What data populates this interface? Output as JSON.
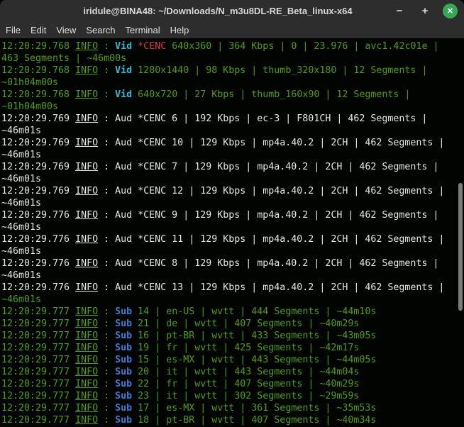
{
  "window": {
    "title": "iridule@BINA48: ~/Downloads/N_m3u8DL-RE_Beta_linux-x64",
    "controls": {
      "minimize": "−",
      "maximize": "+",
      "close": "✕"
    }
  },
  "menubar": {
    "items": [
      "File",
      "Edit",
      "View",
      "Search",
      "Terminal",
      "Help"
    ]
  },
  "colors": {
    "chrome": "#2d2d2d",
    "terminal_bg": "#020402",
    "green": "#539c10",
    "cyan": "#2fb9d4",
    "blue": "#3d7bd8",
    "red": "#e03c3c",
    "white": "#e6e6e6",
    "title_text": "#d8d8d8",
    "menu_text": "#e0e0e0",
    "control_icon": "#dcdcdc",
    "close_button": "#36a854",
    "scrollbar_thumb": "#7d7d7d"
  },
  "terminal": {
    "rows": [
      [
        {
          "t": "12:20:29.768 ",
          "s": "g"
        },
        {
          "t": "INFO",
          "s": "gu"
        },
        {
          "t": " : ",
          "s": "g"
        },
        {
          "t": "Vid",
          "s": "c"
        },
        {
          "t": " ",
          "s": "g"
        },
        {
          "t": "*CENC",
          "s": "r"
        },
        {
          "t": " 640x360 | 364 Kbps | 0 | 23.976 | avc1.42c01e |",
          "s": "g"
        }
      ],
      [
        {
          "t": "463 Segments | ~46m00s",
          "s": "g"
        }
      ],
      [
        {
          "t": "12:20:29.768 ",
          "s": "g"
        },
        {
          "t": "INFO",
          "s": "gu"
        },
        {
          "t": " : ",
          "s": "g"
        },
        {
          "t": "Vid",
          "s": "c"
        },
        {
          "t": " 1280x1440 | 98 Kbps | thumb_320x180 | 12 Segments |",
          "s": "g"
        }
      ],
      [
        {
          "t": "~01h04m00s",
          "s": "g"
        }
      ],
      [
        {
          "t": "12:20:29.768 ",
          "s": "g"
        },
        {
          "t": "INFO",
          "s": "gu"
        },
        {
          "t": " : ",
          "s": "g"
        },
        {
          "t": "Vid",
          "s": "c"
        },
        {
          "t": " 640x720 | 27 Kbps | thumb_160x90 | 12 Segments |",
          "s": "g"
        }
      ],
      [
        {
          "t": "~01h04m00s",
          "s": "g"
        }
      ],
      [
        {
          "t": "12:20:29.769 ",
          "s": "w"
        },
        {
          "t": "INFO",
          "s": "wu"
        },
        {
          "t": " : Aud *CENC 6 | 192 Kbps | ec-3 | F801CH | 462 Segments |",
          "s": "w"
        }
      ],
      [
        {
          "t": "~46m01s",
          "s": "w"
        }
      ],
      [
        {
          "t": "12:20:29.769 ",
          "s": "w"
        },
        {
          "t": "INFO",
          "s": "wu"
        },
        {
          "t": " : Aud *CENC 10 | 129 Kbps | mp4a.40.2 | 2CH | 462 Segments |",
          "s": "w"
        }
      ],
      [
        {
          "t": "~46m01s",
          "s": "w"
        }
      ],
      [
        {
          "t": "12:20:29.769 ",
          "s": "w"
        },
        {
          "t": "INFO",
          "s": "wu"
        },
        {
          "t": " : Aud *CENC 7 | 129 Kbps | mp4a.40.2 | 2CH | 462 Segments |",
          "s": "w"
        }
      ],
      [
        {
          "t": "~46m01s",
          "s": "w"
        }
      ],
      [
        {
          "t": "12:20:29.769 ",
          "s": "w"
        },
        {
          "t": "INFO",
          "s": "wu"
        },
        {
          "t": " : Aud *CENC 12 | 129 Kbps | mp4a.40.2 | 2CH | 462 Segments |",
          "s": "w"
        }
      ],
      [
        {
          "t": "~46m01s",
          "s": "w"
        }
      ],
      [
        {
          "t": "12:20:29.776 ",
          "s": "w"
        },
        {
          "t": "INFO",
          "s": "wu"
        },
        {
          "t": " : Aud *CENC 9 | 129 Kbps | mp4a.40.2 | 2CH | 462 Segments |",
          "s": "w"
        }
      ],
      [
        {
          "t": "~46m01s",
          "s": "w"
        }
      ],
      [
        {
          "t": "12:20:29.776 ",
          "s": "w"
        },
        {
          "t": "INFO",
          "s": "wu"
        },
        {
          "t": " : Aud *CENC 11 | 129 Kbps | mp4a.40.2 | 2CH | 462 Segments |",
          "s": "w"
        }
      ],
      [
        {
          "t": "~46m01s",
          "s": "w"
        }
      ],
      [
        {
          "t": "12:20:29.776 ",
          "s": "w"
        },
        {
          "t": "INFO",
          "s": "wu"
        },
        {
          "t": " : Aud *CENC 8 | 129 Kbps | mp4a.40.2 | 2CH | 462 Segments |",
          "s": "w"
        }
      ],
      [
        {
          "t": "~46m01s",
          "s": "w"
        }
      ],
      [
        {
          "t": "12:20:29.776 ",
          "s": "w"
        },
        {
          "t": "INFO",
          "s": "wu"
        },
        {
          "t": " : Aud *CENC 13 | 129 Kbps | mp4a.40.2 | 2CH | 462 Segments |",
          "s": "w"
        }
      ],
      [
        {
          "t": "~46m01s",
          "s": "g"
        }
      ],
      [
        {
          "t": "12:20:29.777 ",
          "s": "g"
        },
        {
          "t": "INFO",
          "s": "gu"
        },
        {
          "t": " : ",
          "s": "g"
        },
        {
          "t": "Sub",
          "s": "b"
        },
        {
          "t": " 14 | en-US | wvtt | 444 Segments | ~44m10s",
          "s": "g"
        }
      ],
      [
        {
          "t": "12:20:29.777 ",
          "s": "g"
        },
        {
          "t": "INFO",
          "s": "gu"
        },
        {
          "t": " : ",
          "s": "g"
        },
        {
          "t": "Sub",
          "s": "b"
        },
        {
          "t": " 21 | de | wvtt | 407 Segments | ~40m29s",
          "s": "g"
        }
      ],
      [
        {
          "t": "12:20:29.777 ",
          "s": "g"
        },
        {
          "t": "INFO",
          "s": "gu"
        },
        {
          "t": " : ",
          "s": "g"
        },
        {
          "t": "Sub",
          "s": "b"
        },
        {
          "t": " 16 | pt-BR | wvtt | 433 Segments | ~43m05s",
          "s": "g"
        }
      ],
      [
        {
          "t": "12:20:29.777 ",
          "s": "g"
        },
        {
          "t": "INFO",
          "s": "gu"
        },
        {
          "t": " : ",
          "s": "g"
        },
        {
          "t": "Sub",
          "s": "b"
        },
        {
          "t": " 19 | fr | wvtt | 425 Segments | ~42m17s",
          "s": "g"
        }
      ],
      [
        {
          "t": "12:20:29.777 ",
          "s": "g"
        },
        {
          "t": "INFO",
          "s": "gu"
        },
        {
          "t": " : ",
          "s": "g"
        },
        {
          "t": "Sub",
          "s": "b"
        },
        {
          "t": " 15 | es-MX | wvtt | 443 Segments | ~44m05s",
          "s": "g"
        }
      ],
      [
        {
          "t": "12:20:29.777 ",
          "s": "g"
        },
        {
          "t": "INFO",
          "s": "gu"
        },
        {
          "t": " : ",
          "s": "g"
        },
        {
          "t": "Sub",
          "s": "b"
        },
        {
          "t": " 20 | it | wvtt | 443 Segments | ~44m04s",
          "s": "g"
        }
      ],
      [
        {
          "t": "12:20:29.777 ",
          "s": "g"
        },
        {
          "t": "INFO",
          "s": "gu"
        },
        {
          "t": " : ",
          "s": "g"
        },
        {
          "t": "Sub",
          "s": "b"
        },
        {
          "t": " 22 | fr | wvtt | 407 Segments | ~40m29s",
          "s": "g"
        }
      ],
      [
        {
          "t": "12:20:29.777 ",
          "s": "g"
        },
        {
          "t": "INFO",
          "s": "gu"
        },
        {
          "t": " : ",
          "s": "g"
        },
        {
          "t": "Sub",
          "s": "b"
        },
        {
          "t": " 23 | it | wvtt | 302 Segments | ~29m59s",
          "s": "g"
        }
      ],
      [
        {
          "t": "12:20:29.777 ",
          "s": "g"
        },
        {
          "t": "INFO",
          "s": "gu"
        },
        {
          "t": " : ",
          "s": "g"
        },
        {
          "t": "Sub",
          "s": "b"
        },
        {
          "t": " 17 | es-MX | wvtt | 361 Segments | ~35m53s",
          "s": "g"
        }
      ],
      [
        {
          "t": "12:20:29.777 ",
          "s": "g"
        },
        {
          "t": "INFO",
          "s": "gu"
        },
        {
          "t": " : ",
          "s": "g"
        },
        {
          "t": "Sub",
          "s": "b"
        },
        {
          "t": " 18 | pt-BR | wvtt | 407 Segments | ~40m34s",
          "s": "g"
        }
      ]
    ]
  }
}
